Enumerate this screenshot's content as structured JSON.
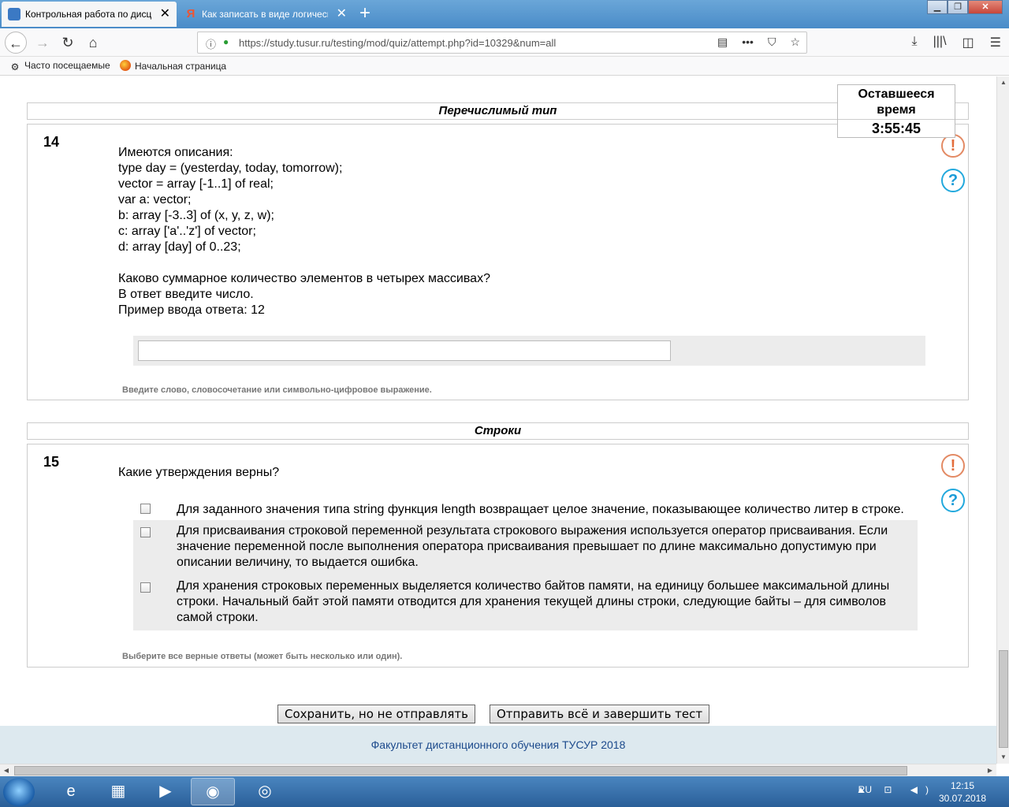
{
  "browser": {
    "tabs": [
      {
        "label": "Контрольная работа по дисциплине",
        "close": "✕"
      },
      {
        "label": "Как записать в виде логического выражения",
        "close": "✕",
        "icon_text": "Я"
      }
    ],
    "new_tab": "+",
    "window_controls": {
      "minimize": "▁",
      "maximize": "❐",
      "close": "✕"
    },
    "url": "https://study.tusur.ru/testing/mod/quiz/attempt.php?id=10329&num=all",
    "url_info_icon": "ⓘ",
    "url_actions": [
      "▤",
      "•••",
      "⛉",
      "☆"
    ],
    "nav_right": [
      "⤓",
      "|||\\",
      "◫",
      "☰"
    ],
    "nav": {
      "back": "←",
      "forward": "→",
      "reload": "↻",
      "home": "⌂"
    },
    "bookmarks": [
      {
        "label": "Часто посещаемые",
        "icon": "gear-icon"
      },
      {
        "label": "Начальная страница",
        "icon": "firefox-icon"
      }
    ]
  },
  "timer": {
    "label": "Оставшееся время",
    "value": "3:55:45"
  },
  "sections": [
    {
      "title": "Перечислимый тип"
    },
    {
      "title": "Строки"
    }
  ],
  "q14": {
    "number": "14",
    "text": "Имеются описания:\ntype day = (yesterday, today, tomorrow);\nvector = array [-1..1] of real;\nvar a: vector;\nb: array [-3..3] of (x, y, z, w);\nc: array ['a'..'z'] of vector;\nd: array [day] of 0..23;\n\nКаково суммарное количество элементов в четырех массивах?\nВ ответ введите число.\nПример ввода ответа: 12",
    "answer_value": "",
    "hint": "Введите слово, словосочетание или символьно-цифровое выражение."
  },
  "q15": {
    "number": "15",
    "text": "Какие утверждения верны?",
    "options": [
      {
        "text": "Для заданного значения типа string функция length возвращает целое значение, показывающее количество литер в строке.",
        "checked": false
      },
      {
        "text": "Для присваивания строковой переменной результата строкового выражения используется оператор присваивания. Если значение переменной после выполнения оператора присваивания превышает по длине максимально допустимую при описании величину, то выдается ошибка.",
        "checked": false
      },
      {
        "text": "Для хранения строковых переменных выделяется количество байтов памяти, на единицу большее максимальной длины строки. Начальный байт этой памяти отводится для хранения текущей длины строки, следующие байты – для символов самой строки.",
        "checked": false
      }
    ],
    "hint": "Выберите все верные ответы (может быть несколько или один)."
  },
  "icons": {
    "flag": "!",
    "help": "?"
  },
  "buttons": {
    "save": "Сохранить, но не отправлять",
    "submit": "Отправить всё и завершить тест"
  },
  "footer": {
    "text": "Факультет дистанционного обучения ТУСУР 2018"
  },
  "taskbar": {
    "lang": "RU",
    "tray_icons": "▲ ⊡ ◀)",
    "time": "12:15",
    "date": "30.07.2018",
    "apps": [
      "ie-icon",
      "explorer-icon",
      "media-player-icon",
      "firefox-icon",
      "chrome-icon"
    ]
  }
}
